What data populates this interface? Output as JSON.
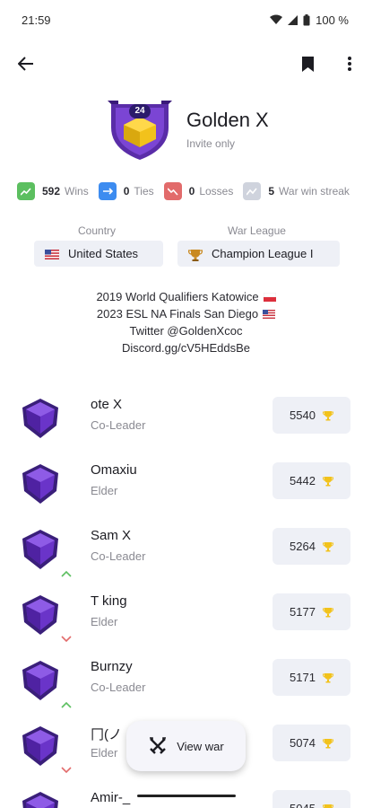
{
  "status_bar": {
    "time": "21:59",
    "battery": "100 %"
  },
  "clan": {
    "name": "Golden X",
    "type": "Invite only",
    "level": "24"
  },
  "stats": [
    {
      "value": "592",
      "label": "Wins",
      "color": "#5cbf60",
      "icon": "trending-up-icon"
    },
    {
      "value": "0",
      "label": "Ties",
      "color": "#3d8cf0",
      "icon": "arrows-horizontal-icon"
    },
    {
      "value": "0",
      "label": "Losses",
      "color": "#e26b6b",
      "icon": "trending-down-icon"
    },
    {
      "value": "5",
      "label": "War win streak",
      "color": "#cfd3dd",
      "icon": "streak-icon"
    }
  ],
  "info": {
    "country_label": "Country",
    "country_value": "United States",
    "war_league_label": "War League",
    "war_league_value": "Champion League I"
  },
  "description": {
    "line1": "2019 World Qualifiers Katowice",
    "line2": "2023 ESL NA Finals San Diego",
    "line3": "Twitter @GoldenXcoc",
    "line4": "Discord.gg/cV5HEddsBe"
  },
  "members": [
    {
      "name": "ote X",
      "role": "Co-Leader",
      "trophies": "5540",
      "trend": "none"
    },
    {
      "name": "Omaxiu",
      "role": "Elder",
      "trophies": "5442",
      "trend": "none"
    },
    {
      "name": "Sam X",
      "role": "Co-Leader",
      "trophies": "5264",
      "trend": "up"
    },
    {
      "name": "T king",
      "role": "Elder",
      "trophies": "5177",
      "trend": "down"
    },
    {
      "name": "Burnzy",
      "role": "Co-Leader",
      "trophies": "5171",
      "trend": "up"
    },
    {
      "name": "冂(ノ",
      "role": "Elder",
      "trophies": "5074",
      "trend": "down"
    },
    {
      "name": "Amir-_",
      "role": "",
      "trophies": "5045",
      "trend": "none"
    }
  ],
  "fab": {
    "label": "View war",
    "icon": "crossed-swords-icon"
  },
  "colors": {
    "up": "#5cbf60",
    "down": "#e26b6b",
    "trophy": "#f2c21b",
    "badge": "#6a34c9"
  }
}
